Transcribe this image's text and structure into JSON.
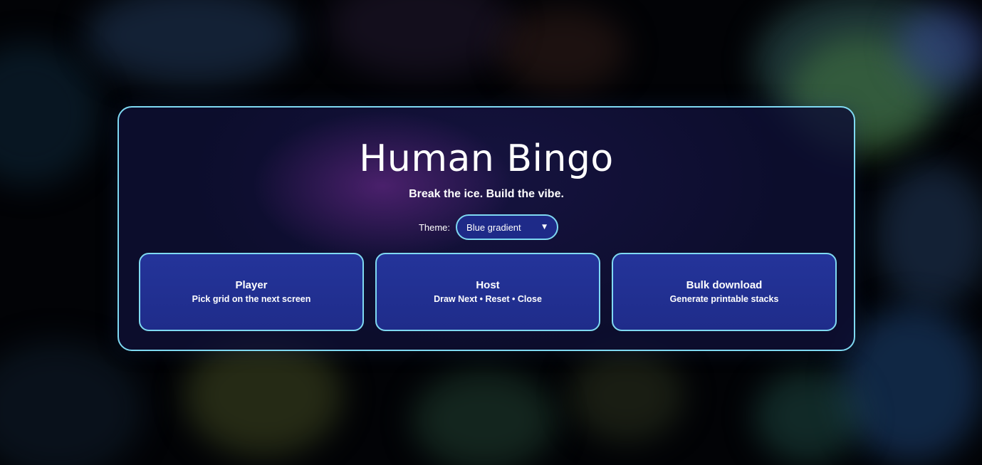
{
  "app": {
    "title": "Human Bingo",
    "tagline": "Break the ice. Build the vibe."
  },
  "theme": {
    "label": "Theme:",
    "selected": "Blue gradient",
    "caret_icon": "chevron-down-icon"
  },
  "cards": [
    {
      "title": "Player",
      "subtitle": "Pick grid on the next screen"
    },
    {
      "title": "Host",
      "subtitle": "Draw Next • Reset • Close"
    },
    {
      "title": "Bulk download",
      "subtitle": "Generate printable stacks"
    }
  ],
  "colors": {
    "accent_border": "#7fd9f2",
    "card_fill": "#22319a",
    "panel_fill": "#0e1034",
    "text": "#ffffff"
  }
}
